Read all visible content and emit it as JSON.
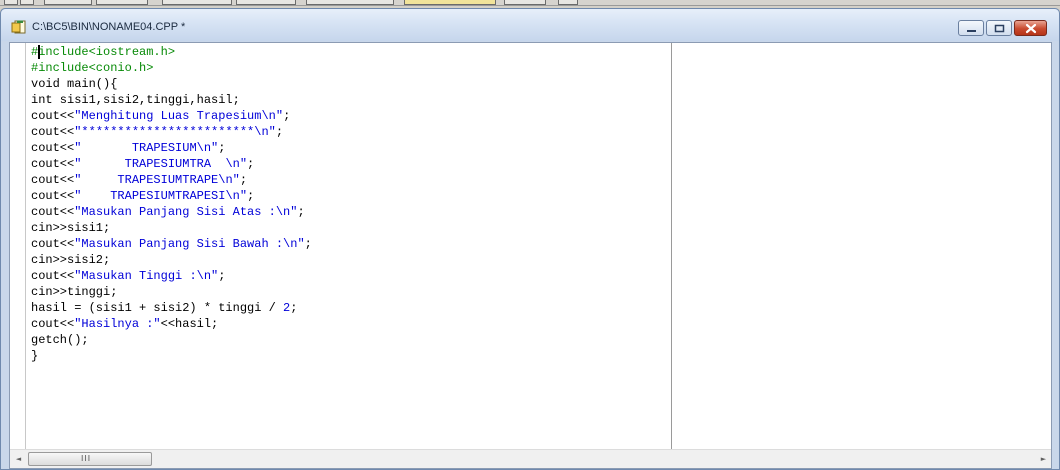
{
  "window": {
    "title": "C:\\BC5\\BIN\\NONAME04.CPP *"
  },
  "colors": {
    "directive": "#078a07",
    "string": "#0000d8",
    "plain": "#000000",
    "close_button": "#c94a2f"
  },
  "icons": [
    "toolbar-button-icon",
    "source-file-icon",
    "minimize-icon",
    "maximize-icon",
    "close-icon",
    "scroll-left-icon",
    "scroll-right-icon",
    "scroll-grip-icon"
  ],
  "scrollbar": {
    "grip": "III",
    "left_arrow": "◄",
    "right_arrow": "►"
  },
  "code_lines": [
    [
      {
        "t": "directive",
        "s": "#include<iostream.h>"
      }
    ],
    [
      {
        "t": "directive",
        "s": "#include<conio.h>"
      }
    ],
    [
      {
        "t": "plain",
        "s": "void main(){"
      }
    ],
    [
      {
        "t": "plain",
        "s": "int sisi1,sisi2,tinggi,hasil;"
      }
    ],
    [
      {
        "t": "plain",
        "s": "cout<<"
      },
      {
        "t": "string",
        "s": "\"Menghitung Luas Trapesium\\n\""
      },
      {
        "t": "plain",
        "s": ";"
      }
    ],
    [
      {
        "t": "plain",
        "s": "cout<<"
      },
      {
        "t": "string",
        "s": "\"************************\\n\""
      },
      {
        "t": "plain",
        "s": ";"
      }
    ],
    [
      {
        "t": "plain",
        "s": "cout<<"
      },
      {
        "t": "string",
        "s": "\"       TRAPESIUM\\n\""
      },
      {
        "t": "plain",
        "s": ";"
      }
    ],
    [
      {
        "t": "plain",
        "s": "cout<<"
      },
      {
        "t": "string",
        "s": "\"      TRAPESIUMTRA  \\n\""
      },
      {
        "t": "plain",
        "s": ";"
      }
    ],
    [
      {
        "t": "plain",
        "s": "cout<<"
      },
      {
        "t": "string",
        "s": "\"     TRAPESIUMTRAPE\\n\""
      },
      {
        "t": "plain",
        "s": ";"
      }
    ],
    [
      {
        "t": "plain",
        "s": "cout<<"
      },
      {
        "t": "string",
        "s": "\"    TRAPESIUMTRAPESI\\n\""
      },
      {
        "t": "plain",
        "s": ";"
      }
    ],
    [
      {
        "t": "plain",
        "s": "cout<<"
      },
      {
        "t": "string",
        "s": "\"Masukan Panjang Sisi Atas :\\n\""
      },
      {
        "t": "plain",
        "s": ";"
      }
    ],
    [
      {
        "t": "plain",
        "s": "cin>>sisi1;"
      }
    ],
    [
      {
        "t": "plain",
        "s": "cout<<"
      },
      {
        "t": "string",
        "s": "\"Masukan Panjang Sisi Bawah :\\n\""
      },
      {
        "t": "plain",
        "s": ";"
      }
    ],
    [
      {
        "t": "plain",
        "s": "cin>>sisi2;"
      }
    ],
    [
      {
        "t": "plain",
        "s": "cout<<"
      },
      {
        "t": "string",
        "s": "\"Masukan Tinggi :\\n\""
      },
      {
        "t": "plain",
        "s": ";"
      }
    ],
    [
      {
        "t": "plain",
        "s": "cin>>tinggi;"
      }
    ],
    [
      {
        "t": "plain",
        "s": "hasil = (sisi1 + sisi2) * tinggi / "
      },
      {
        "t": "number",
        "s": "2"
      },
      {
        "t": "plain",
        "s": ";"
      }
    ],
    [
      {
        "t": "plain",
        "s": "cout<<"
      },
      {
        "t": "string",
        "s": "\"Hasilnya :\""
      },
      {
        "t": "plain",
        "s": "<<hasil;"
      }
    ],
    [
      {
        "t": "plain",
        "s": "getch();"
      }
    ],
    [
      {
        "t": "plain",
        "s": "}"
      }
    ]
  ]
}
